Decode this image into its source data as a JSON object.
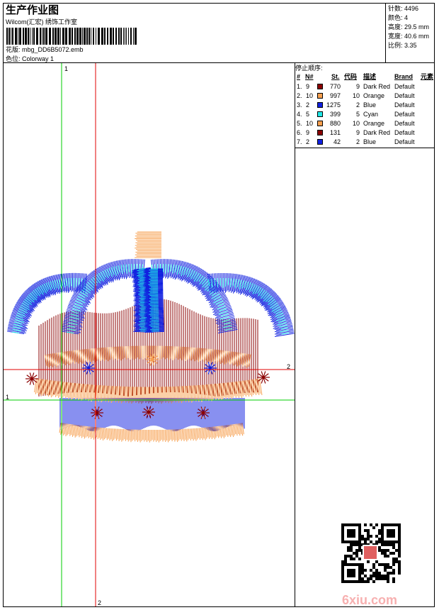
{
  "header": {
    "title": "生产作业图",
    "company": "Wilcom(汇宏) 绣饰工作室",
    "design_file": "花版: mbg_DD6B5072.emb",
    "colorway": "色位: Colorway 1"
  },
  "stats": {
    "stitches": "针数: 4496",
    "colors": "颜色: 4",
    "height": "高度: 29.5 mm",
    "width": "宽度: 40.6 mm",
    "scale": "比例: 3.35"
  },
  "stop_sequence": {
    "title": "停止顺序:",
    "headers": {
      "index": "#",
      "needle": "N#",
      "stitches": "St.",
      "code": "代码",
      "description": "描述",
      "brand": "Brand",
      "element": "元素"
    },
    "rows": [
      {
        "index": "1.",
        "needle": "9",
        "stitches": "770",
        "code": "9",
        "description": "Dark Red",
        "brand": "Default",
        "color": "#8b0000"
      },
      {
        "index": "2.",
        "needle": "10",
        "stitches": "997",
        "code": "10",
        "description": "Orange",
        "brand": "Default",
        "color": "#f7a050"
      },
      {
        "index": "3.",
        "needle": "2",
        "stitches": "1275",
        "code": "2",
        "description": "Blue",
        "brand": "Default",
        "color": "#1020e0"
      },
      {
        "index": "4.",
        "needle": "5",
        "stitches": "399",
        "code": "5",
        "description": "Cyan",
        "brand": "Default",
        "color": "#20e8e8"
      },
      {
        "index": "5.",
        "needle": "10",
        "stitches": "880",
        "code": "10",
        "description": "Orange",
        "brand": "Default",
        "color": "#f7a050"
      },
      {
        "index": "6.",
        "needle": "9",
        "stitches": "131",
        "code": "9",
        "description": "Dark Red",
        "brand": "Default",
        "color": "#8b0000"
      },
      {
        "index": "7.",
        "needle": "2",
        "stitches": "42",
        "code": "2",
        "description": "Blue",
        "brand": "Default",
        "color": "#1020e0"
      }
    ]
  },
  "guides": {
    "v1_label": "1",
    "v2_label": "2",
    "h1_label": "1",
    "h2_label": "2",
    "green": "#00cc00",
    "red": "#e00000"
  },
  "watermark": "6xiu.com",
  "thread_colors": {
    "dark_red": "#8b0000",
    "orange": "#f7a050",
    "blue": "#1020e0",
    "cyan": "#20e8e8"
  }
}
